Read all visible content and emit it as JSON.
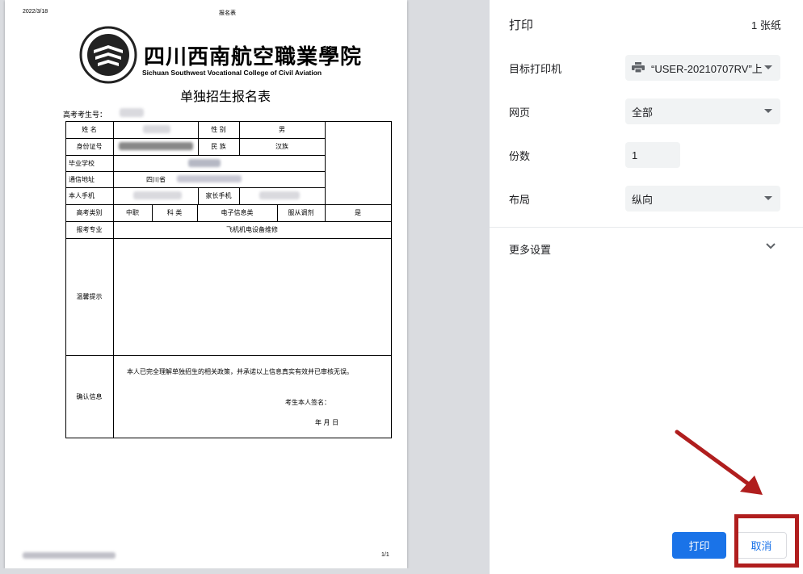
{
  "document": {
    "header_date": "2022/3/18",
    "header_title": "报名表",
    "school_name_cn": "四川西南航空職業學院",
    "school_name_en": "Sichuan Southwest Vocational College of Civil Aviation",
    "form_title": "单独招生报名表",
    "exam_number_label": "高考考生号：",
    "footer_page": "1/1",
    "table": {
      "name_label": "姓 名",
      "gender_label": "性 别",
      "gender_value": "男",
      "id_label": "身份证号",
      "ethnicity_label": "民 族",
      "ethnicity_value": "汉族",
      "school_label": "毕业学校",
      "address_label": "通信地址",
      "address_value": "四川省",
      "phone_label": "本人手机",
      "parent_phone_label": "家长手机",
      "category_label": "高考类别",
      "category_value1": "中职",
      "category_value2": "科 类",
      "category_value3": "电子信息类",
      "adjust_label": "服从调剂",
      "adjust_value": "是",
      "major_label": "报考专业",
      "major_value": "飞机机电设备维修",
      "tips_label": "温馨提示",
      "confirm_label": "确认信息",
      "confirm_text": "本人已完全理解单独招生的相关政策，并承诺以上信息真实有效并已审核无误。",
      "signature_label": "考生本人签名：",
      "date_label": "年  月  日"
    }
  },
  "settings": {
    "title": "打印",
    "sheet_count": "1 张纸",
    "printer_label": "目标打印机",
    "printer_value": "“USER-20210707RV”上",
    "pages_label": "网页",
    "pages_value": "全部",
    "copies_label": "份数",
    "copies_value": "1",
    "layout_label": "布局",
    "layout_value": "纵向",
    "more_settings_label": "更多设置",
    "print_button": "打印",
    "cancel_button": "取消"
  },
  "colors": {
    "accent": "#1a73e8",
    "highlight_red": "#b01e1e",
    "preview_bg": "#dadce0"
  }
}
